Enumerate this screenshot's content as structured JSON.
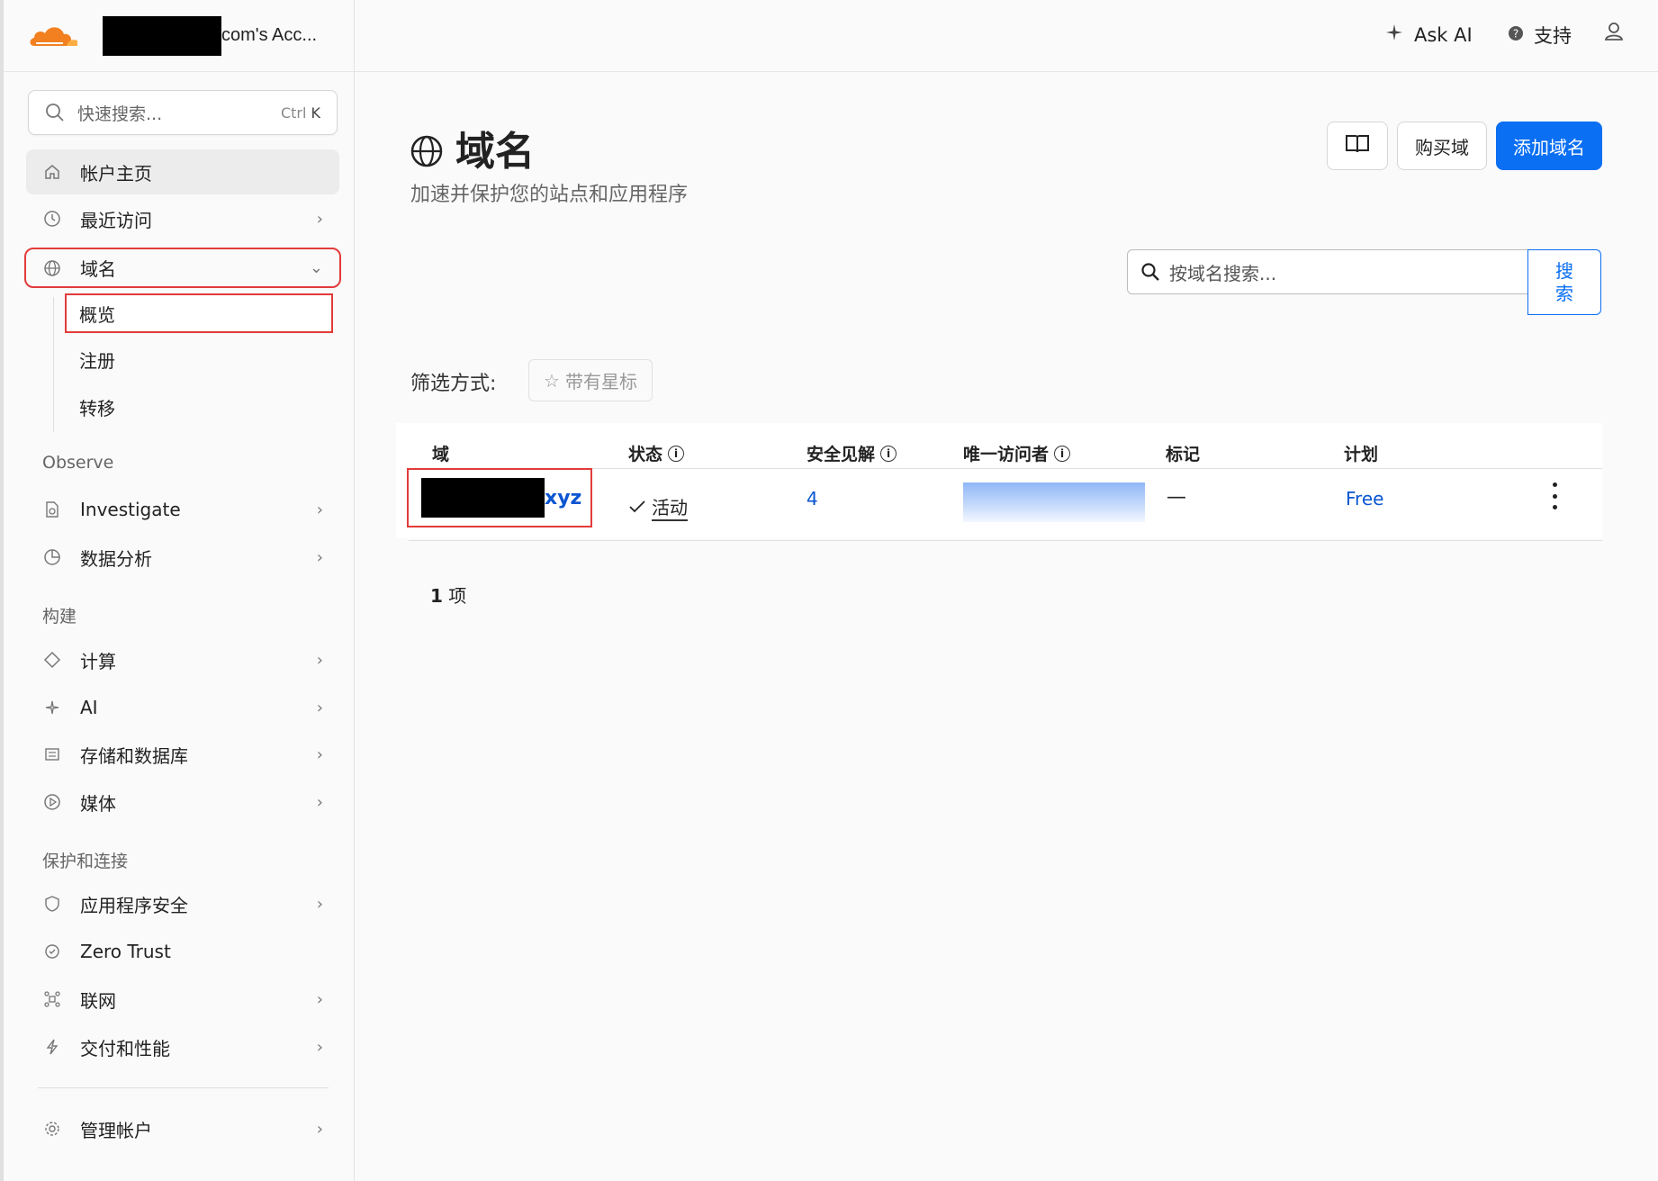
{
  "account": {
    "name_suffix": "com's Acc..."
  },
  "search": {
    "placeholder": "快速搜索...",
    "shortcut_ctrl": "Ctrl",
    "shortcut_key": "K"
  },
  "sidebar": {
    "items": [
      {
        "label": "帐户主页",
        "icon": "home-icon"
      },
      {
        "label": "最近访问",
        "icon": "clock-icon"
      },
      {
        "label": "域名",
        "icon": "globe-icon"
      }
    ],
    "domain_sub": [
      "概览",
      "注册",
      "转移"
    ],
    "sections": {
      "observe": "Observe",
      "build": "构建",
      "protect": "保护和连接"
    },
    "observe_items": [
      {
        "label": "Investigate",
        "icon": "document-search-icon"
      },
      {
        "label": "数据分析",
        "icon": "pie-chart-icon"
      }
    ],
    "build_items": [
      {
        "label": "计算",
        "icon": "diamond-icon"
      },
      {
        "label": "AI",
        "icon": "sparkle-icon"
      },
      {
        "label": "存储和数据库",
        "icon": "database-icon"
      },
      {
        "label": "媒体",
        "icon": "play-icon"
      }
    ],
    "protect_items": [
      {
        "label": "应用程序安全",
        "icon": "shield-icon"
      },
      {
        "label": "Zero Trust",
        "icon": "zero-trust-icon"
      },
      {
        "label": "联网",
        "icon": "network-icon"
      },
      {
        "label": "交付和性能",
        "icon": "bolt-icon"
      }
    ],
    "manage": {
      "label": "管理帐户",
      "icon": "gear-icon"
    }
  },
  "topbar": {
    "ask_ai": "Ask AI",
    "support": "支持"
  },
  "page": {
    "title": "域名",
    "subtitle": "加速并保护您的站点和应用程序",
    "buy_domain": "购买域",
    "add_domain": "添加域名"
  },
  "domain_search": {
    "placeholder": "按域名搜索...",
    "button_line1": "搜",
    "button_line2": "索"
  },
  "filter": {
    "label": "筛选方式:",
    "starred": "带有星标"
  },
  "table": {
    "headers": {
      "domain": "域",
      "status": "状态",
      "security": "安全见解",
      "visitors": "唯一访问者",
      "tags": "标记",
      "plan": "计划"
    },
    "rows": [
      {
        "domain_suffix": "xyz",
        "status": "活动",
        "security": "4",
        "tags": "—",
        "plan": "Free"
      }
    ]
  },
  "count": {
    "number": "1",
    "unit": "项"
  },
  "colors": {
    "accent": "#0a6ff2",
    "highlight": "#e23b3b",
    "link": "#0a55d1"
  }
}
